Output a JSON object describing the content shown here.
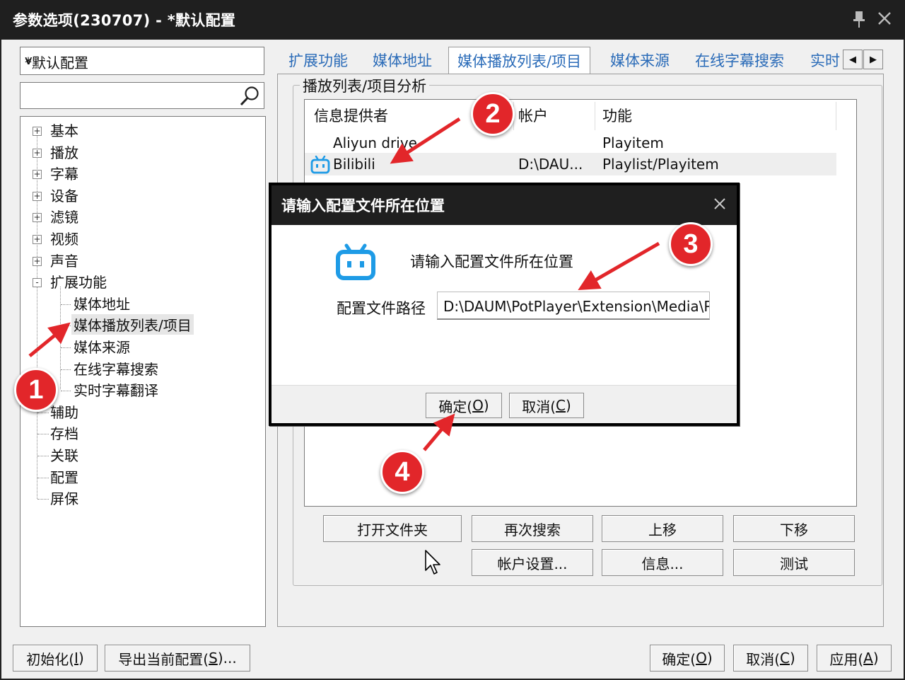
{
  "window": {
    "title": "参数选项(230707) - *默认配置"
  },
  "profile": {
    "selected": "*默认配置",
    "arrow": "v"
  },
  "search": {
    "value": ""
  },
  "tree": {
    "items": [
      {
        "label": "基本",
        "expand": "+"
      },
      {
        "label": "播放",
        "expand": "+"
      },
      {
        "label": "字幕",
        "expand": "+"
      },
      {
        "label": "设备",
        "expand": "+"
      },
      {
        "label": "滤镜",
        "expand": "+"
      },
      {
        "label": "视频",
        "expand": "+"
      },
      {
        "label": "声音",
        "expand": "+"
      },
      {
        "label": "扩展功能",
        "expand": "-"
      },
      {
        "label": "辅助"
      },
      {
        "label": "存档"
      },
      {
        "label": "关联"
      },
      {
        "label": "配置"
      },
      {
        "label": "屏保"
      }
    ],
    "children": [
      "媒体地址",
      "媒体播放列表/项目",
      "媒体来源",
      "在线字幕搜索",
      "实时字幕翻译"
    ]
  },
  "tabs": [
    "扩展功能",
    "媒体地址",
    "媒体播放列表/项目",
    "媒体来源",
    "在线字幕搜索",
    "实时"
  ],
  "group": {
    "label": "播放列表/项目分析"
  },
  "list": {
    "headers": [
      "信息提供者",
      "帐户",
      "功能"
    ],
    "rows": [
      {
        "provider": "Aliyun drive",
        "account": "",
        "function": "Playitem"
      },
      {
        "provider": "Bilibili",
        "account": "D:\\DAU...",
        "function": "Playlist/Playitem"
      }
    ]
  },
  "buttons": {
    "open_folder": "打开文件夹",
    "research": "再次搜索",
    "move_up": "上移",
    "move_down": "下移",
    "account_settings": "帐户设置...",
    "info": "信息...",
    "test": "测试"
  },
  "dialog": {
    "title": "请输入配置文件所在位置",
    "message": "请输入配置文件所在位置",
    "path_label": "配置文件路径",
    "path_value": "D:\\DAUM\\PotPlayer\\Extension\\Media\\Pla",
    "ok_text": "确定(",
    "ok_key": "O",
    "cancel_text": "取消(",
    "cancel_key": "C",
    "close_paren": ")"
  },
  "footer": {
    "init_text": "初始化(",
    "init_key": "I",
    "export_text": "导出当前配置(",
    "export_key": "S",
    "export_tail": ")...",
    "ok_text": "确定(",
    "ok_key": "O",
    "cancel_text": "取消(",
    "cancel_key": "C",
    "apply_text": "应用(",
    "apply_key": "A",
    "close_paren": ")"
  },
  "annotations": [
    "1",
    "2",
    "3",
    "4"
  ],
  "colors": {
    "accent_tab": "#2a6bb8",
    "badge": "#e2262a",
    "bilibili": "#1e9be6",
    "titlebar": "#1f1f1f"
  }
}
